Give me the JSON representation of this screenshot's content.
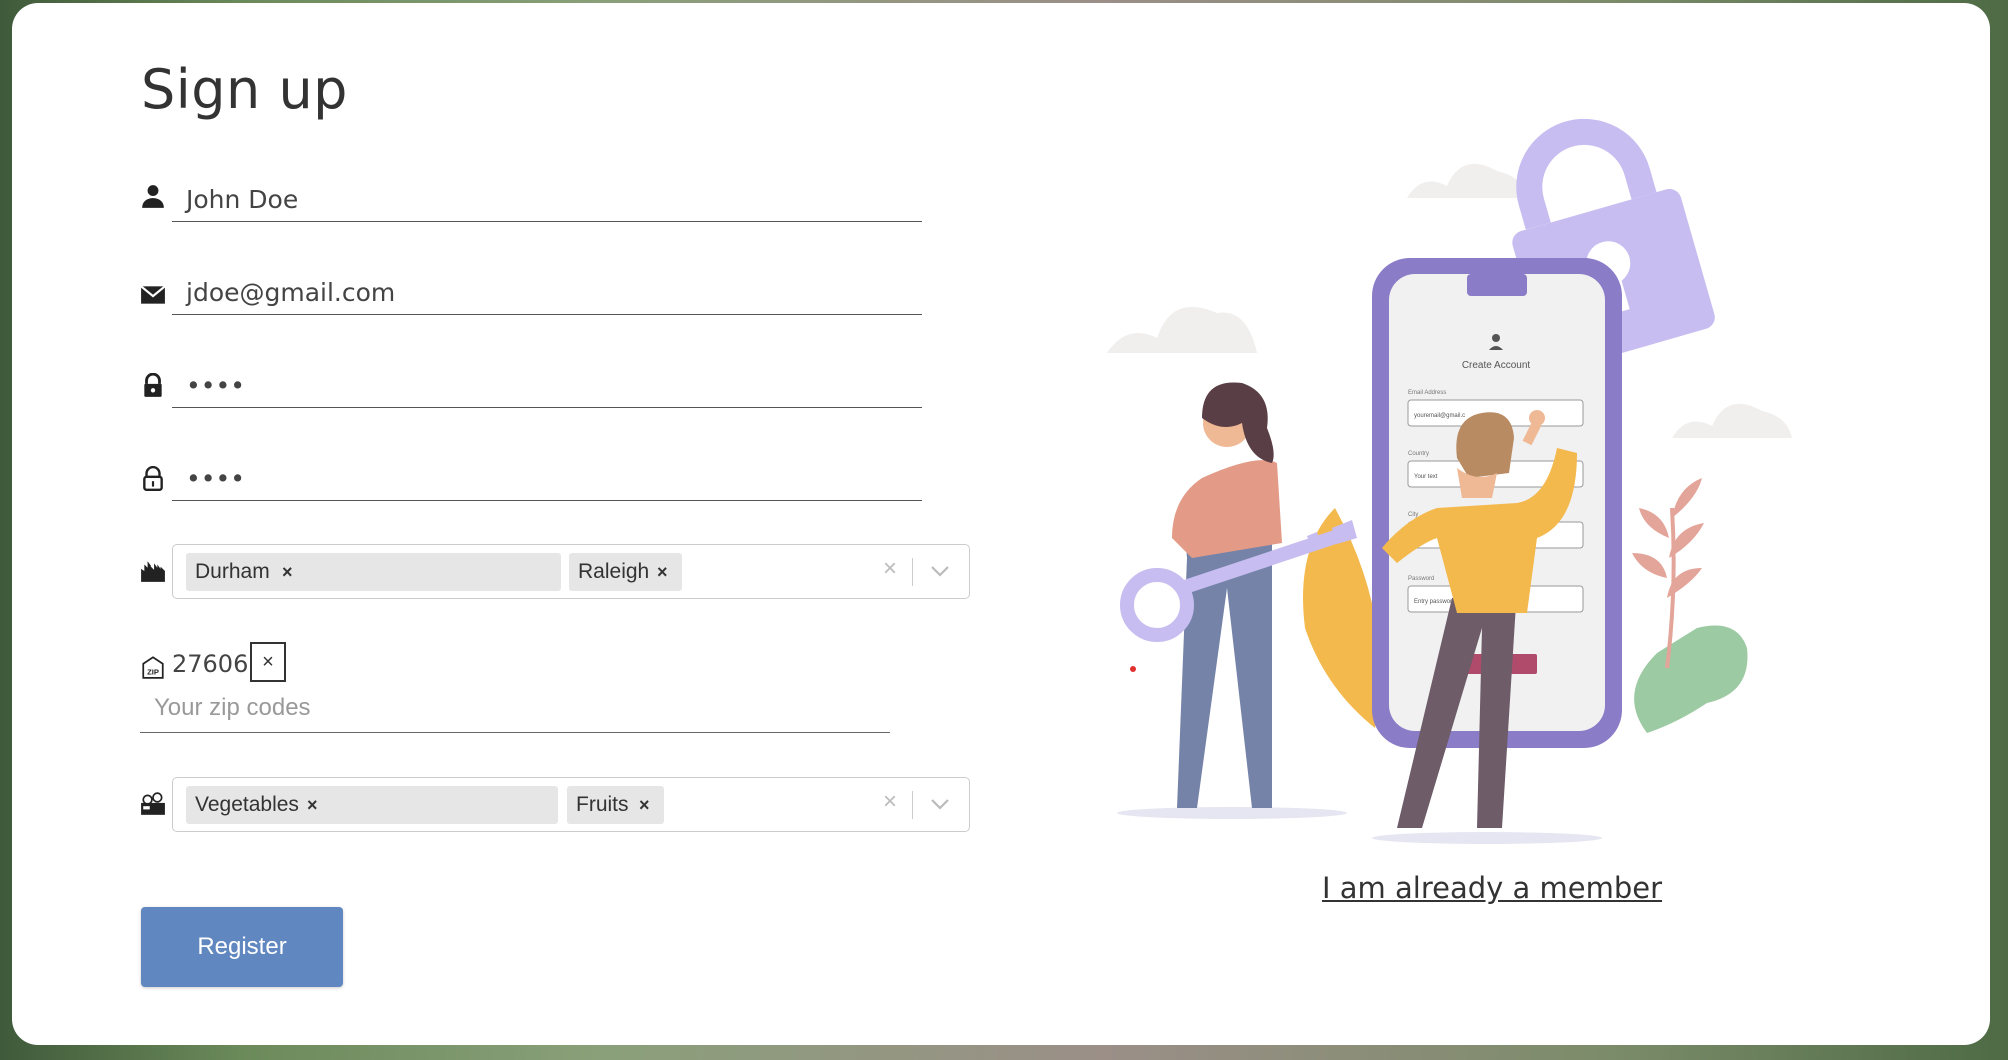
{
  "form": {
    "title": "Sign up",
    "name": {
      "value": "John Doe",
      "icon": "user-icon"
    },
    "email": {
      "value": "jdoe@gmail.com",
      "icon": "envelope-icon"
    },
    "password": {
      "value": "••••",
      "icon": "lock-icon"
    },
    "confirm_password": {
      "value": "••••",
      "icon": "lock-open-icon"
    },
    "cities": {
      "icon": "city-icon",
      "selected": [
        "Durham",
        "Raleigh"
      ]
    },
    "zip": {
      "icon": "zip-icon",
      "tag": "27606",
      "remove": "×",
      "placeholder": "Your zip codes"
    },
    "foods": {
      "icon": "groceries-icon",
      "selected": [
        "Vegetables",
        "Fruits"
      ]
    },
    "chip_remove": "×",
    "clear": "×",
    "register_label": "Register"
  },
  "side": {
    "member_link": "I am already a member",
    "phone": {
      "heading": "Create Account",
      "email_label": "Email Address",
      "email_value": "youremail@gmail.c",
      "country_label": "Country",
      "country_value": "Your text",
      "city_label": "City",
      "password_label": "Password",
      "password_value": "Entry password"
    }
  },
  "colors": {
    "accent": "#6187c0",
    "lavender": "#c7bdf0",
    "purple": "#8a7cc7"
  }
}
